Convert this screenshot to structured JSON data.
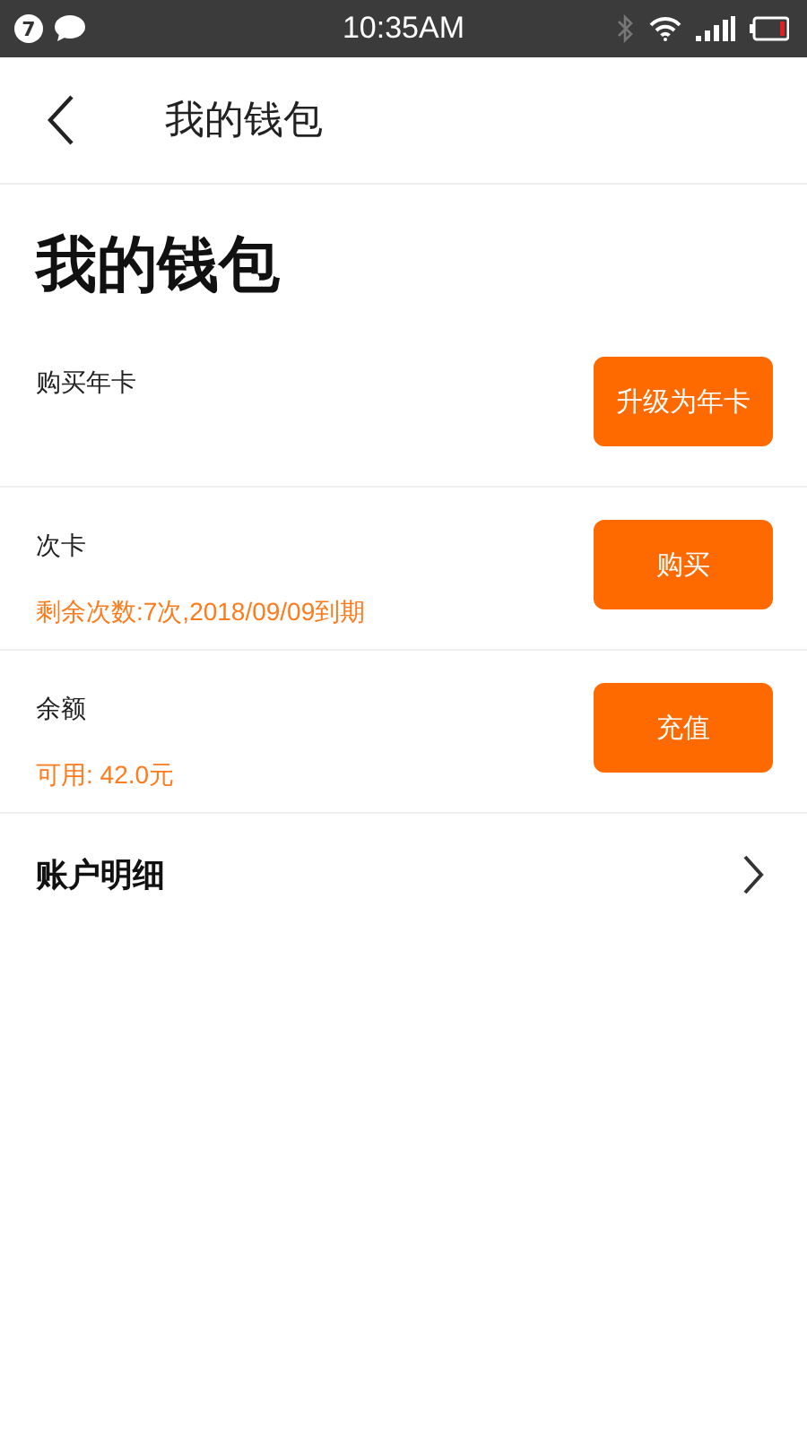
{
  "status_bar": {
    "badge": "7",
    "time": "10:35AM"
  },
  "header": {
    "title": "我的钱包"
  },
  "page_title": "我的钱包",
  "rows": [
    {
      "label": "购买年卡",
      "button": "升级为年卡"
    },
    {
      "label": "次卡",
      "detail": "剩余次数:7次,2018/09/09到期",
      "button": "购买"
    },
    {
      "label": "余额",
      "detail": "可用: 42.0元",
      "button": "充值"
    }
  ],
  "account_detail": {
    "label": "账户明细"
  }
}
